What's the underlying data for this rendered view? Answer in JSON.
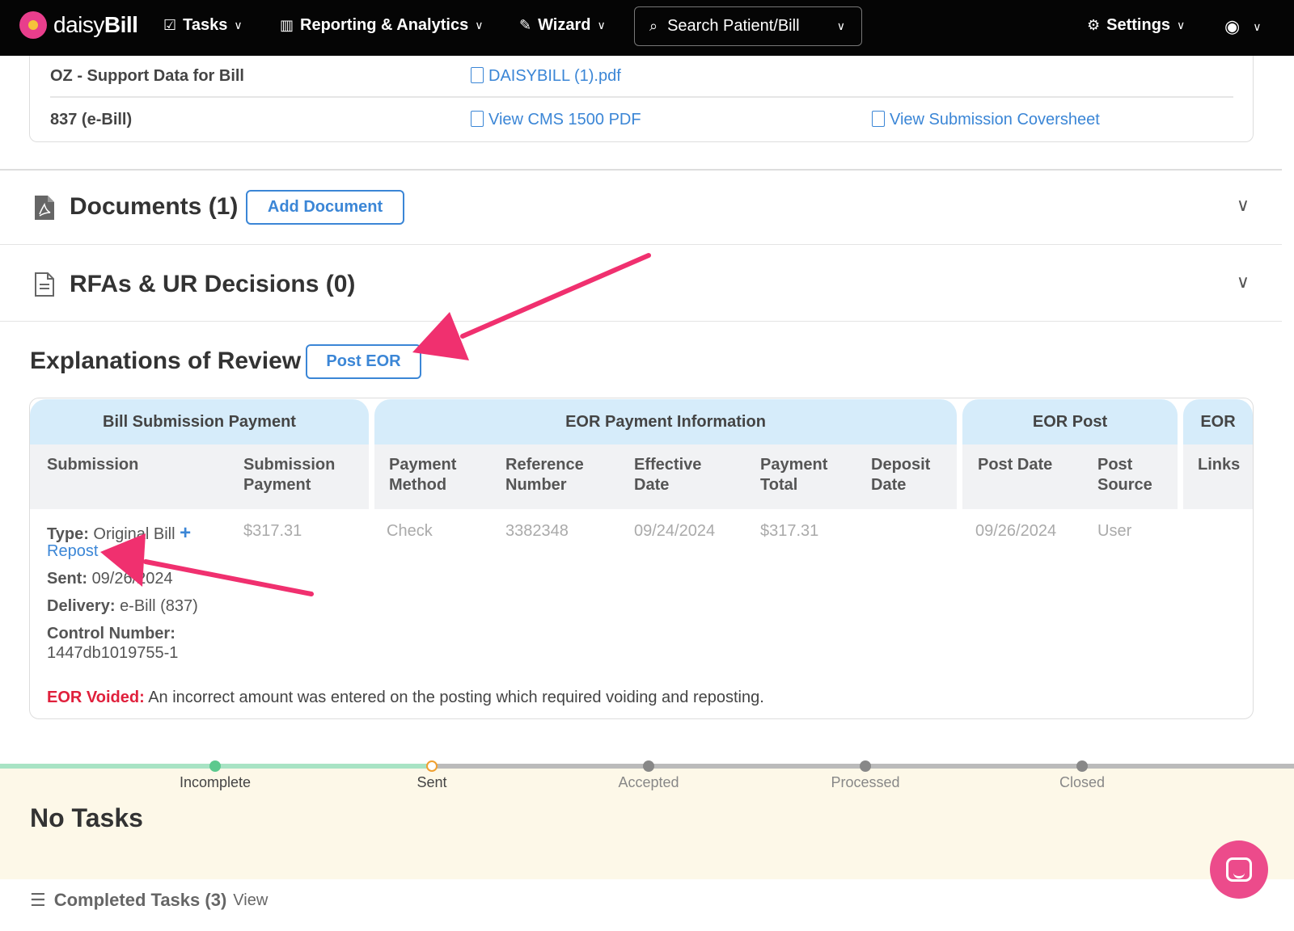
{
  "nav": {
    "brand_light": "daisy",
    "brand_bold": "Bill",
    "tasks": "Tasks",
    "reporting": "Reporting & Analytics",
    "wizard": "Wizard",
    "search": "Search Patient/Bill",
    "settings": "Settings"
  },
  "bill_forms": {
    "row1": {
      "label": "OZ - Support Data for Bill",
      "link1": "DAISYBILL (1).pdf"
    },
    "row2": {
      "label": "837 (e-Bill)",
      "link1": "View CMS 1500 PDF",
      "link2": "View Submission Coversheet"
    }
  },
  "documents": {
    "title": "Documents (1)",
    "button": "Add Document"
  },
  "rfas": {
    "title": "RFAs & UR Decisions (0)"
  },
  "eor": {
    "title": "Explanations of Review",
    "post_button": "Post EOR",
    "groups": [
      "Bill Submission Payment",
      "EOR Payment Information",
      "EOR Post",
      "EOR"
    ],
    "headers": {
      "submission": "Submission",
      "submission_payment_1": "Submission",
      "submission_payment_2": "Payment",
      "payment_method_1": "Payment",
      "payment_method_2": "Method",
      "reference_1": "Reference",
      "reference_2": "Number",
      "effective_1": "Effective",
      "effective_2": "Date",
      "payment_total_1": "Payment",
      "payment_total_2": "Total",
      "deposit_1": "Deposit",
      "deposit_2": "Date",
      "post_date": "Post Date",
      "post_source_1": "Post",
      "post_source_2": "Source",
      "links": "Links"
    },
    "row": {
      "type_label": "Type:",
      "type_value": "Original Bill",
      "repost": "Repost",
      "sent_label": "Sent:",
      "sent_value": "09/26/2024",
      "delivery_label": "Delivery:",
      "delivery_value": "e-Bill (837)",
      "control_label": "Control Number:",
      "control_value": "1447db1019755-1",
      "submission_payment": "$317.31",
      "payment_method": "Check",
      "reference_number": "3382348",
      "effective_date": "09/24/2024",
      "payment_total": "$317.31",
      "post_date": "09/26/2024",
      "post_source": "User"
    },
    "voided_label": "EOR Voided:",
    "voided_text": "An incorrect amount was entered on the posting which required voiding and reposting."
  },
  "tracker": {
    "steps": [
      "Incomplete",
      "Sent",
      "Accepted",
      "Processed",
      "Closed"
    ],
    "colors": {
      "done": "#5cc98e",
      "current": "#f0a030",
      "pending": "#888888"
    }
  },
  "tasks": {
    "no_tasks": "No Tasks",
    "completed": "Completed Tasks (3)",
    "view": "View"
  },
  "annotation_color": "#f0306f"
}
